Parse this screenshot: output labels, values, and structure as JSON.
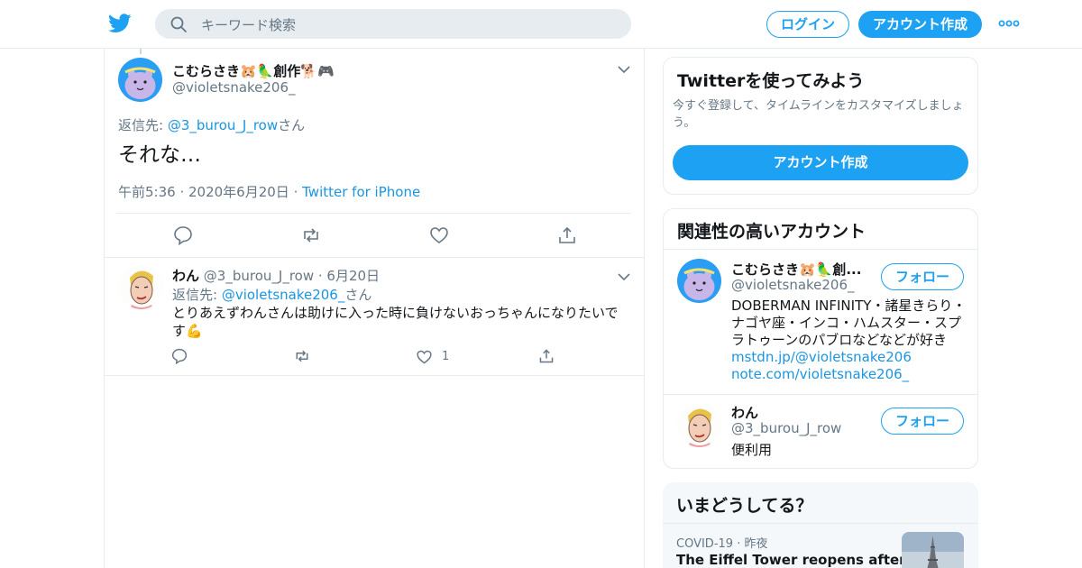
{
  "header": {
    "search_placeholder": "キーワード検索",
    "login_label": "ログイン",
    "signup_label": "アカウント作成"
  },
  "main_tweet": {
    "display_name": "こむらさき🐹🦜創作🐕🎮",
    "handle": "@violetsnake206_",
    "reply_prefix": "返信先: ",
    "reply_to": "@3_burou_J_row",
    "reply_suffix": "さん",
    "text": "それな…",
    "time": "午前5:36",
    "date": "2020年6月20日",
    "source": "Twitter for iPhone"
  },
  "reply_tweet": {
    "display_name": "わん",
    "handle": "@3_burou_J_row",
    "date": "6月20日",
    "reply_prefix": "返信先: ",
    "reply_to": "@violetsnake206_",
    "reply_suffix": "さん",
    "text": "とりあえずわんさんは助けに入った時に負けないおっちゃんになりたいです💪",
    "like_count": "1"
  },
  "signup_card": {
    "title": "Twitterを使ってみよう",
    "body": "今すぐ登録して、タイムラインをカスタマイズしましょう。",
    "button": "アカウント作成"
  },
  "related": {
    "title": "関連性の高いアカウント",
    "follow_label": "フォロー",
    "accounts": [
      {
        "name": "こむらさき🐹🦜創...",
        "handle": "@violetsnake206_",
        "bio": "DOBERMAN INFINITY・諸星きらり・ナゴヤ座・インコ・ハムスター・スプラトゥーンのパブロなどなどが好き",
        "links": [
          "mstdn.jp/@violetsnake206",
          "note.com/violetsnake206_"
        ]
      },
      {
        "name": "わん",
        "handle": "@3_burou_J_row",
        "bio": "便利用"
      }
    ]
  },
  "trends": {
    "title": "いまどうしてる？",
    "items": [
      {
        "category": "COVID-19",
        "when": "昨夜",
        "headline": "The Eiffel Tower reopens after more"
      }
    ]
  },
  "colors": {
    "accent": "#1da1f2",
    "link": "#1b95e0",
    "muted": "#657786",
    "border": "#e6ecf0"
  }
}
